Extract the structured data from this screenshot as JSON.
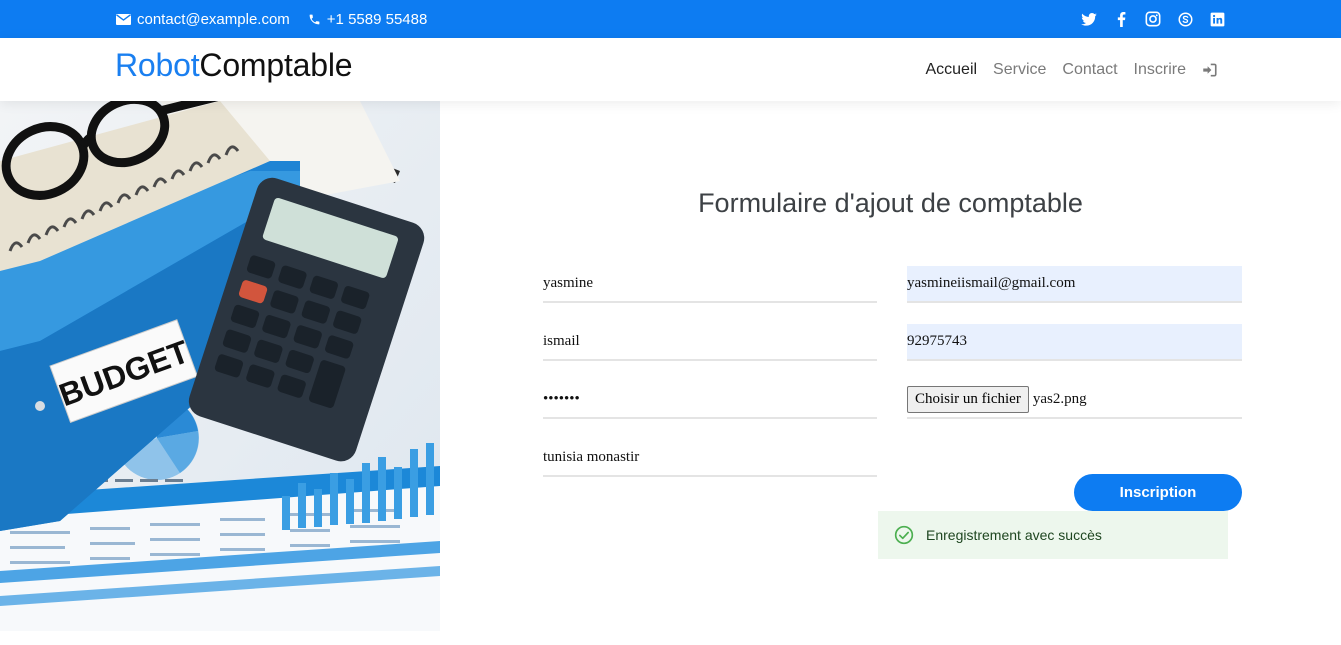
{
  "topbar": {
    "email": "contact@example.com",
    "phone": "+1 5589 55488",
    "social": [
      "twitter-icon",
      "facebook-icon",
      "instagram-icon",
      "skype-icon",
      "linkedin-icon"
    ]
  },
  "header": {
    "logo_part1": "Robot",
    "logo_part2": "Comptable",
    "nav": [
      "Accueil",
      "Service",
      "Contact",
      "Inscrire"
    ],
    "active_nav": "Accueil"
  },
  "hero": {
    "budget_label": "BUDGET"
  },
  "form": {
    "title": "Formulaire d'ajout de comptable",
    "first_name": "yasmine",
    "last_name": "ismail",
    "password": "•••••••",
    "address": "tunisia monastir",
    "email": "yasmineiismail@gmail.com",
    "phone": "92975743",
    "file_button": "Choisir un fichier",
    "file_name": "yas2.png",
    "submit_label": "Inscription"
  },
  "toast": {
    "message": "Enregistrement avec succès"
  },
  "colors": {
    "brand": "#0d7cf2",
    "success_bg": "#edf7ed",
    "autofill_bg": "#e8f0fe"
  }
}
